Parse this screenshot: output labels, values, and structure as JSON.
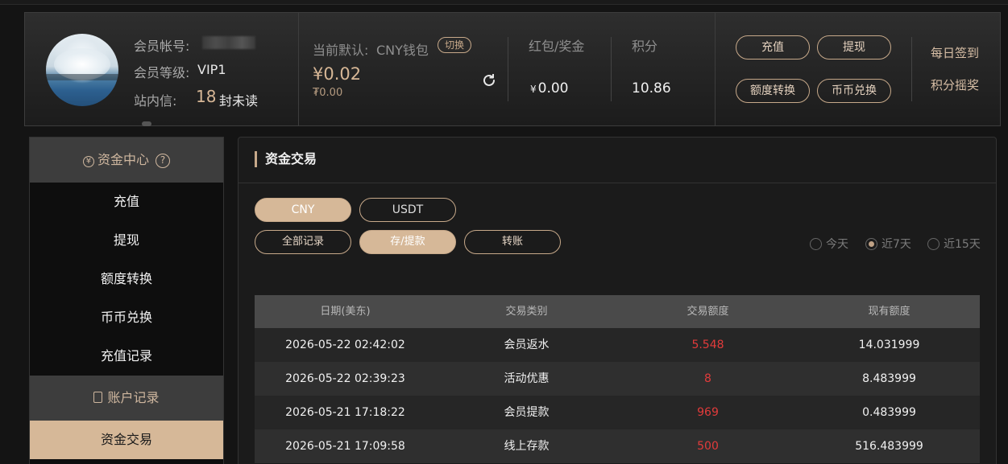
{
  "header": {
    "account_label": "会员帐号:",
    "level_label": "会员等级:",
    "level_value": "VIP1",
    "inbox_label": "站内信:",
    "inbox_count": "18",
    "inbox_suffix": "封未读",
    "wallet_label": "当前默认:",
    "wallet_name": "CNY钱包",
    "switch_label": "切换",
    "balance_main": "¥0.02",
    "balance_sub": "₮0.00",
    "redpack_label": "红包/奖金",
    "redpack_currency": "¥",
    "redpack_value": "0.00",
    "points_label": "积分",
    "points_value": "10.86",
    "buttons": {
      "deposit": "充值",
      "withdraw": "提现",
      "transfer": "额度转换",
      "exchange": "币币兑换"
    },
    "daily_signin": "每日签到",
    "points_lottery": "积分摇奖"
  },
  "sidebar": {
    "fund_center": "资金中心",
    "help": "?",
    "fund_items": [
      "充值",
      "提现",
      "额度转换",
      "币币兑换",
      "充值记录"
    ],
    "account_records": "账户记录",
    "active_item": "资金交易"
  },
  "main": {
    "title": "资金交易",
    "currency_tabs": [
      "CNY",
      "USDT"
    ],
    "filter_tabs": [
      "全部记录",
      "存/提款",
      "转账"
    ],
    "ranges": [
      "今天",
      "近7天",
      "近15天"
    ],
    "selected_range": "近7天",
    "columns": [
      "日期(美东)",
      "交易类别",
      "交易额度",
      "现有额度"
    ],
    "rows": [
      [
        "2026-05-22 02:42:02",
        "会员返水",
        "5.548",
        "14.031999"
      ],
      [
        "2026-05-22 02:39:23",
        "活动优惠",
        "8",
        "8.483999"
      ],
      [
        "2026-05-21 17:18:22",
        "会员提款",
        "969",
        "0.483999"
      ],
      [
        "2026-05-21 17:09:58",
        "线上存款",
        "500",
        "516.483999"
      ]
    ]
  },
  "colors": {
    "accent": "#d6b898",
    "amount_red": "#e23b3b"
  }
}
